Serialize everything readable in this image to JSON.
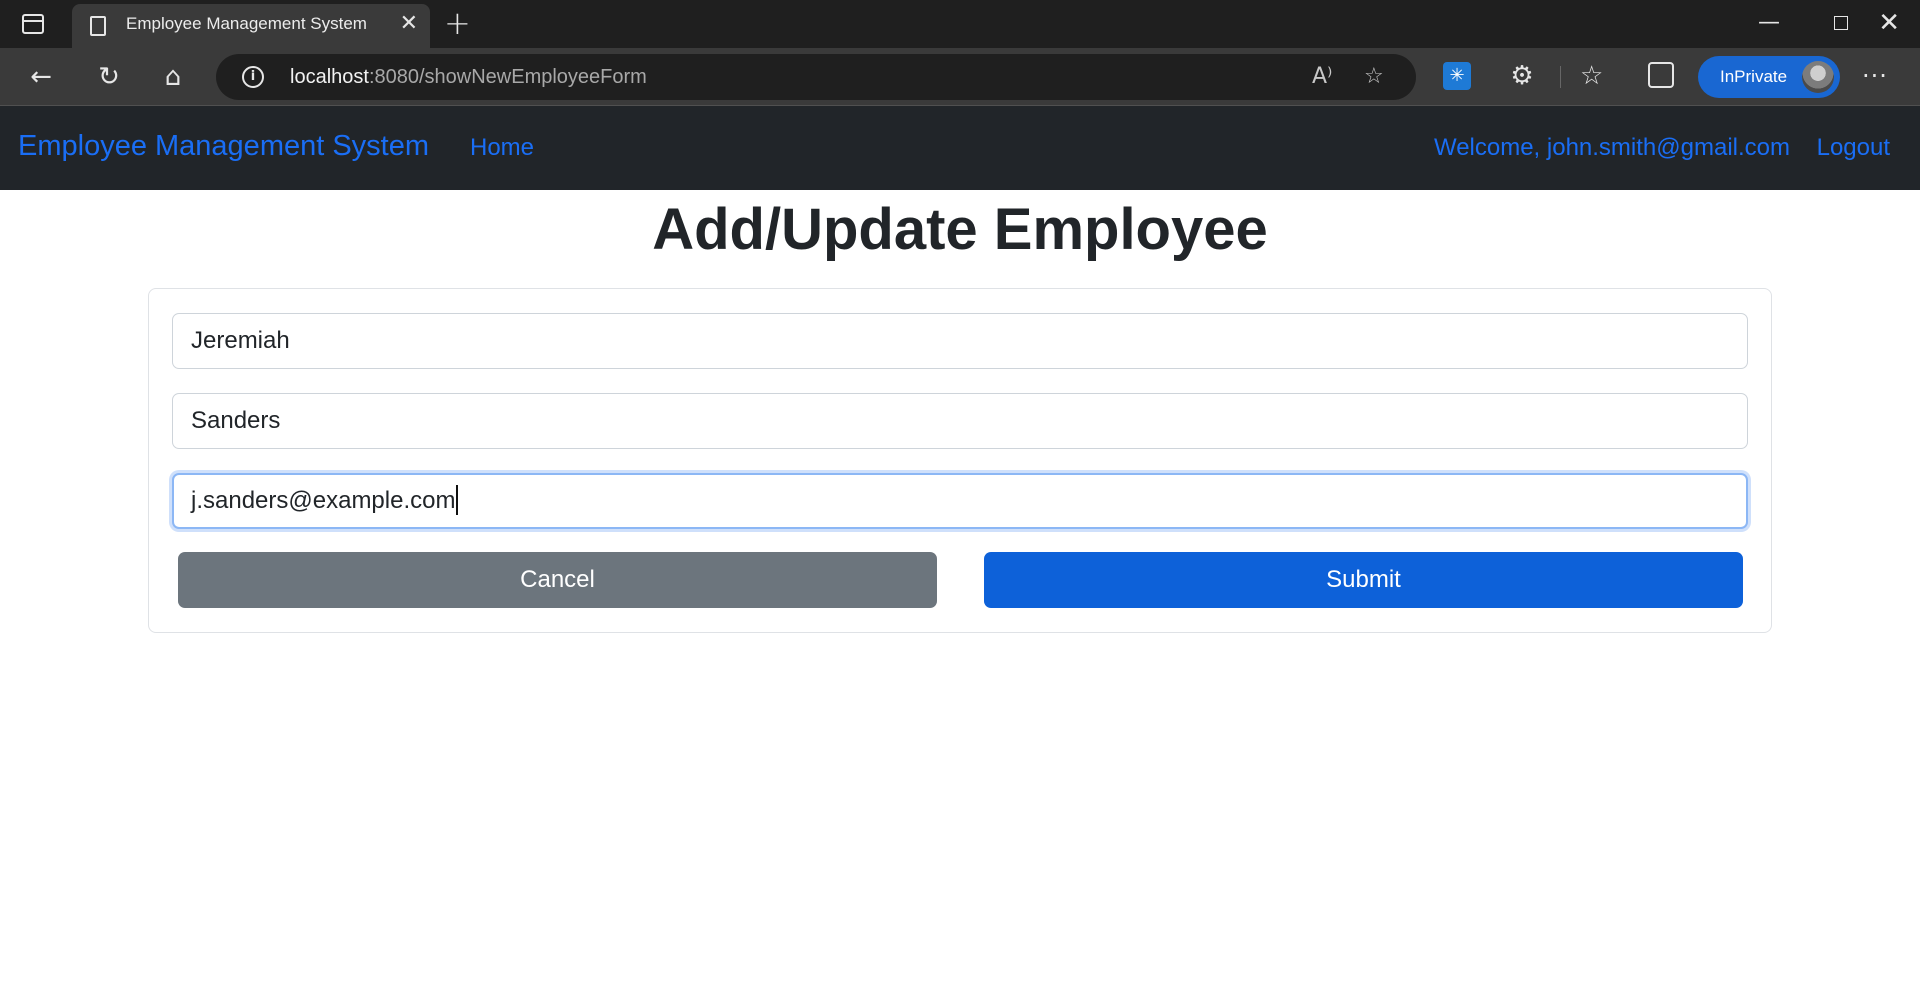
{
  "browser": {
    "tab_title": "Employee Management System",
    "address_host": "localhost",
    "address_path": ":8080/showNewEmployeeForm",
    "inprivate_label": "InPrivate"
  },
  "navbar": {
    "brand": "Employee Management System",
    "home_label": "Home",
    "welcome_text": "Welcome, john.smith@gmail.com",
    "logout_label": "Logout"
  },
  "form": {
    "title": "Add/Update Employee",
    "first_name_value": "Jeremiah",
    "last_name_value": "Sanders",
    "email_value": "j.sanders@example.com",
    "cancel_label": "Cancel",
    "submit_label": "Submit"
  },
  "colors": {
    "navbar_bg": "#212529",
    "link": "#1a6ef5",
    "cancel_bg": "#6c757d",
    "submit_bg": "#0d61d9"
  }
}
